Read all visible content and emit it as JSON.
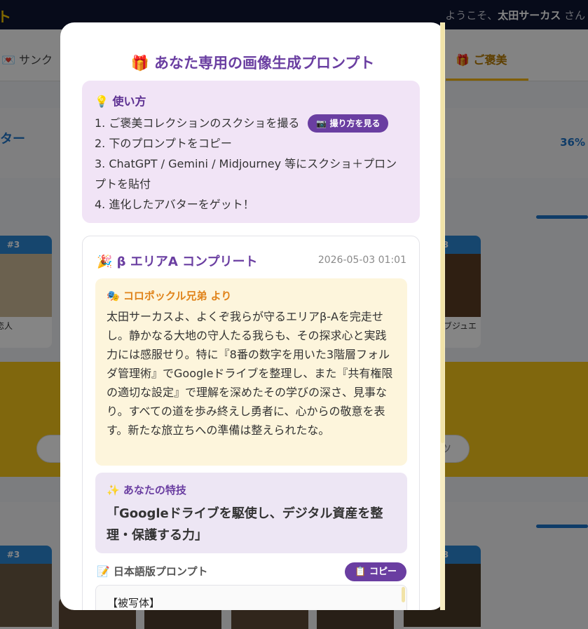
{
  "app": {
    "brand": "ト",
    "welcome_prefix": "ようこそ、",
    "user_name": "太田サーカス",
    "welcome_suffix": " さん"
  },
  "nav": {
    "left_tab": "💌 サンク",
    "right_tab": "🎁 ご褒美"
  },
  "background": {
    "progress_label": "ター",
    "progress_percent": "36%",
    "cards_row1": [
      {
        "rank": "#3",
        "name": "白い恋人"
      },
      {
        "rank": "#3",
        "name": "ブジュエ"
      }
    ],
    "cards_row2": [
      {
        "rank": "#3"
      },
      {
        "rank": "#3"
      }
    ],
    "pill_right_text": "ツ"
  },
  "modal": {
    "title": "🎁 あなた専用の画像生成プロンプト",
    "howto": {
      "title": "💡 使い方",
      "steps": [
        "1. ご褒美コレクションのスクショを撮る",
        "2. 下のプロンプトをコピー",
        "3. ChatGPT / Gemini / Midjourney 等にスクショ＋プロンプトを貼付",
        "4. 進化したアバターをゲット！"
      ],
      "howto_button": "📷 撮り方を見る"
    },
    "achievement": {
      "title": "🎉 β エリアA コンプリート",
      "date": "2026-05-03 01:01",
      "message_from": "🎭 コロポックル兄弟 より",
      "message_body": "太田サーカスよ、よくぞ我らが守るエリアβ-Aを完走せし。静かなる大地の守人たる我らも、その探求心と実践力には感服せり。特に『8番の数字を用いた3階層フォルダ管理術』でGoogleドライブを整理し、また『共有権限の適切な設定』で理解を深めたその学びの深さ、見事なり。すべての道を歩み終えし勇者に、心からの敬意を表す。新たな旅立ちへの準備は整えられたな。",
      "skill_label": "✨ あなたの特技",
      "skill_text": "「Googleドライブを駆使し、デジタル資産を整理・保護する力」",
      "prompt_header": "📝 日本語版プロンプト",
      "copy_button": "📋 コピー",
      "prompt_first_line": "【被写体】"
    }
  },
  "colors": {
    "accent_purple": "#6a3ea1",
    "howto_bg": "#f1e4f6",
    "message_bg": "#fdf5dc",
    "skill_bg": "#ede6f4",
    "brand_yellow": "#f5c51a",
    "rank_blue": "#2b87d4"
  }
}
